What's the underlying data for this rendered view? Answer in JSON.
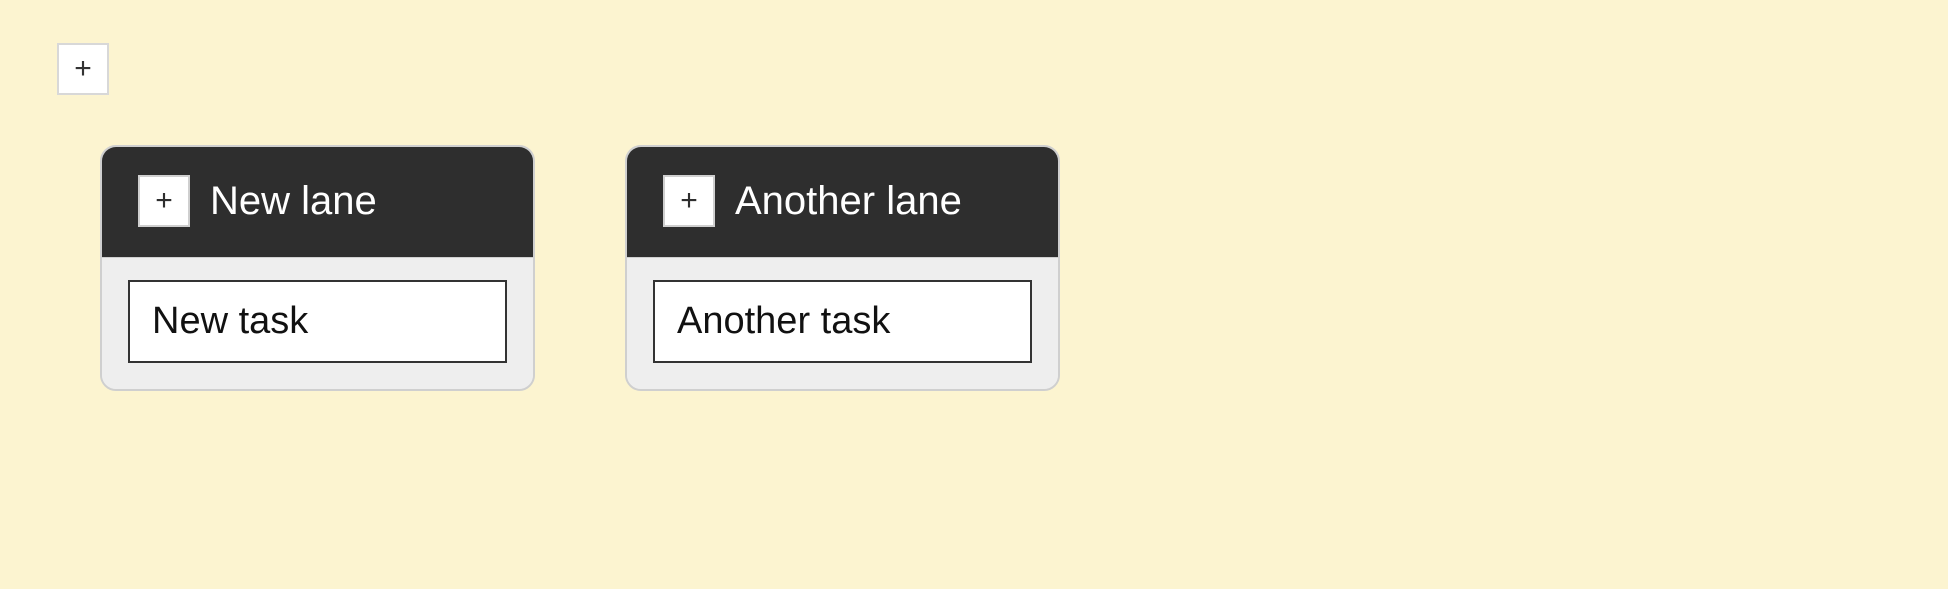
{
  "lanes": [
    {
      "title": "New lane",
      "tasks": [
        {
          "title": "New task"
        }
      ]
    },
    {
      "title": "Another lane",
      "tasks": [
        {
          "title": "Another task"
        }
      ]
    }
  ]
}
